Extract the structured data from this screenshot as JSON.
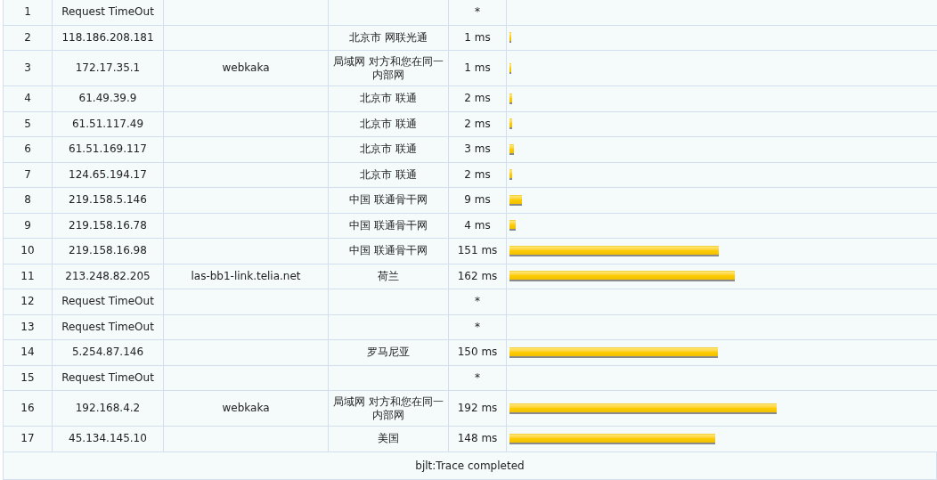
{
  "hops": [
    {
      "hop": "1",
      "ip": "Request TimeOut",
      "time": "*"
    },
    {
      "hop": "2",
      "ip": "118.186.208.181",
      "location": "北京市 网联光通",
      "time": "1 ms",
      "level": 0.004
    },
    {
      "hop": "3",
      "ip": "172.17.35.1",
      "host": "webkaka",
      "location": "局域网 对方和您在同一内部网",
      "time": "1 ms",
      "level": 0.004
    },
    {
      "hop": "4",
      "ip": "61.49.39.9",
      "location": "北京市 联通",
      "time": "2 ms",
      "level": 0.007
    },
    {
      "hop": "5",
      "ip": "61.51.117.49",
      "location": "北京市 联通",
      "time": "2 ms",
      "level": 0.007
    },
    {
      "hop": "6",
      "ip": "61.51.169.117",
      "location": "北京市 联通",
      "time": "3 ms",
      "level": 0.01
    },
    {
      "hop": "7",
      "ip": "124.65.194.17",
      "location": "北京市 联通",
      "time": "2 ms",
      "level": 0.007
    },
    {
      "hop": "8",
      "ip": "219.158.5.146",
      "location": "中国 联通骨干网",
      "time": "9 ms",
      "level": 0.029
    },
    {
      "hop": "9",
      "ip": "219.158.16.78",
      "location": "中国 联通骨干网",
      "time": "4 ms",
      "level": 0.015
    },
    {
      "hop": "10",
      "ip": "219.158.16.98",
      "location": "中国 联通骨干网",
      "time": "151 ms",
      "level": 0.49
    },
    {
      "hop": "11",
      "ip": "213.248.82.205",
      "host": "las-bb1-link.telia.net",
      "location": "荷兰",
      "time": "162 ms",
      "level": 0.527
    },
    {
      "hop": "12",
      "ip": "Request TimeOut",
      "time": "*"
    },
    {
      "hop": "13",
      "ip": "Request TimeOut",
      "time": "*"
    },
    {
      "hop": "14",
      "ip": "5.254.87.146",
      "location": "罗马尼亚",
      "time": "150 ms",
      "level": 0.488
    },
    {
      "hop": "15",
      "ip": "Request TimeOut",
      "time": "*"
    },
    {
      "hop": "16",
      "ip": "192.168.4.2",
      "host": "webkaka",
      "location": "局域网 对方和您在同一内部网",
      "time": "192 ms",
      "level": 0.625
    },
    {
      "hop": "17",
      "ip": "45.134.145.10",
      "location": "美国",
      "time": "148 ms",
      "level": 0.481
    }
  ],
  "footer": "bjlt:Trace completed"
}
